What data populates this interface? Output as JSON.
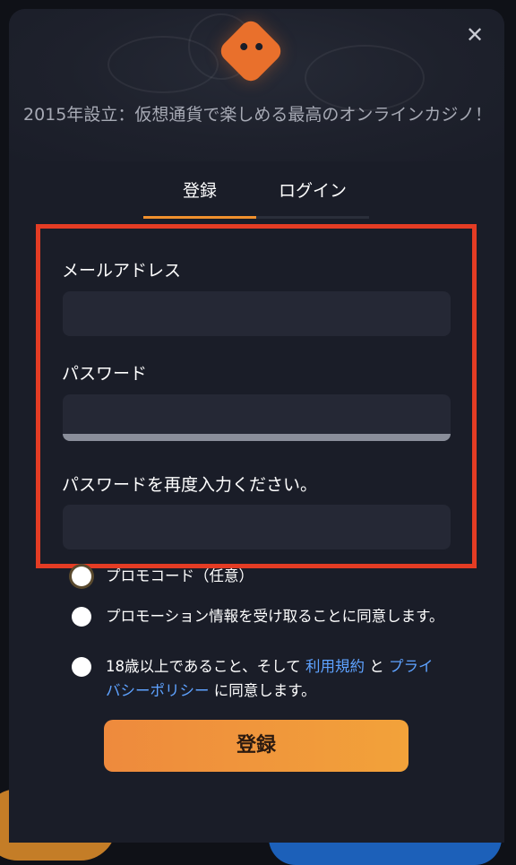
{
  "header": {
    "tagline": "2015年設立：仮想通貨で楽しめる最高のオンラインカジノ！",
    "close_icon": "close-icon",
    "logo_icon": "dice-logo-icon"
  },
  "tabs": [
    {
      "label": "登録",
      "active": true
    },
    {
      "label": "ログイン",
      "active": false
    }
  ],
  "form": {
    "email_label": "メールアドレス",
    "email_value": "",
    "password_label": "パスワード",
    "password_value": "",
    "password_confirm_label": "パスワードを再度入力ください。",
    "password_confirm_value": ""
  },
  "options": {
    "promo_code": "プロモコード（任意）",
    "promo_consent": "プロモーション情報を受け取ることに同意します。",
    "age_prefix": "18歳以上であること、そして",
    "terms_link": "利用規約",
    "and": "と",
    "privacy_link": "プライバシーポリシー",
    "age_suffix": "に同意します。"
  },
  "submit_label": "登録",
  "colors": {
    "accent": "#f0902d",
    "highlight_border": "#e43c24",
    "link": "#5ea2ff",
    "panel": "#1a1d28"
  }
}
